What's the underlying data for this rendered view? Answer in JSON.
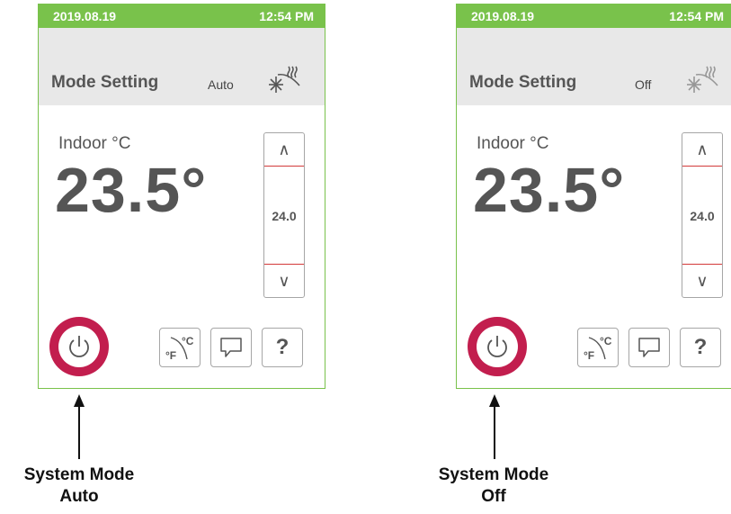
{
  "panels": [
    {
      "statusbar": {
        "date": "2019.08.19",
        "time": "12:54 PM"
      },
      "mode": {
        "title": "Mode Setting",
        "value": "Auto",
        "icon": "snowflake-heat-icon"
      },
      "indoor": {
        "label": "Indoor °C",
        "temperature": "23.5°"
      },
      "setpoint": {
        "up_symbol": "∧",
        "down_symbol": "∨",
        "value": "24.0"
      },
      "toolbar": {
        "help_label": "?"
      },
      "caption": {
        "line1": "System Mode",
        "line2": "Auto"
      }
    },
    {
      "statusbar": {
        "date": "2019.08.19",
        "time": "12:54 PM"
      },
      "mode": {
        "title": "Mode Setting",
        "value": "Off",
        "icon": "snowflake-heat-icon"
      },
      "indoor": {
        "label": "Indoor °C",
        "temperature": "23.5°"
      },
      "setpoint": {
        "up_symbol": "∧",
        "down_symbol": "∨",
        "value": "24.0"
      },
      "toolbar": {
        "help_label": "?"
      },
      "caption": {
        "line1": "System Mode",
        "line2": "Off"
      }
    }
  ],
  "colors": {
    "accent_green": "#79c24b",
    "power_ring": "#c21e4e",
    "setpoint_divider": "#d33a3a"
  },
  "icons": [
    "power-icon",
    "unit-toggle-icon",
    "message-icon",
    "help-icon",
    "snowflake-heat-icon"
  ]
}
